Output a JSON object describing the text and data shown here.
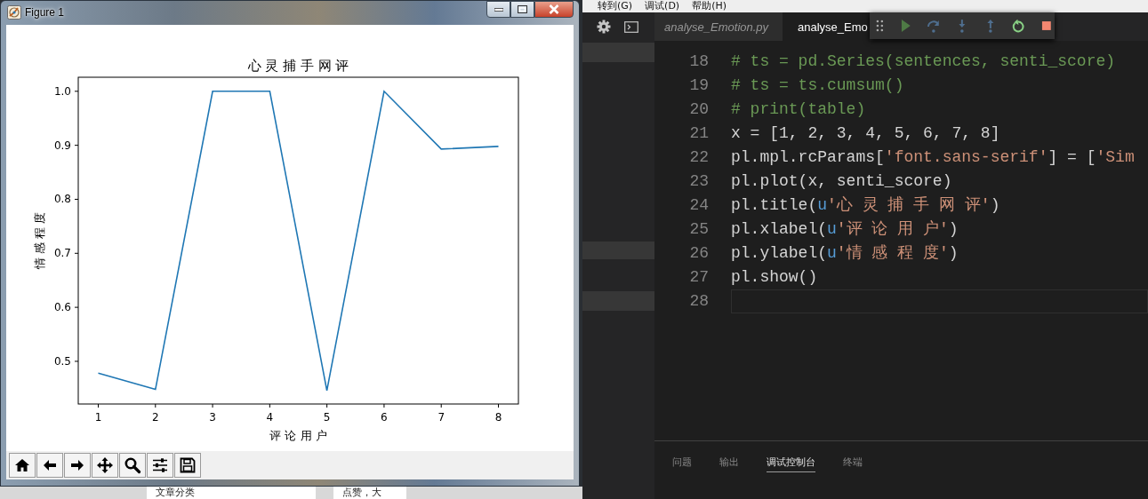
{
  "desktop": {
    "panels": [
      "文章分类",
      "点赞，大"
    ]
  },
  "figure_window": {
    "title": "Figure 1",
    "chart_data": {
      "type": "line",
      "title": "心 灵 捕 手 网 评",
      "xlabel": "评 论 用 户",
      "ylabel": "情 感 程 度",
      "x": [
        1,
        2,
        3,
        4,
        5,
        6,
        7,
        8
      ],
      "series": [
        {
          "color": "#1f77b4",
          "values": [
            0.478,
            0.448,
            1.0,
            1.0,
            0.446,
            1.0,
            0.893,
            0.898
          ]
        }
      ],
      "xlim": [
        0.65,
        8.35
      ],
      "ylim": [
        0.421,
        1.026
      ],
      "xticks": [
        1,
        2,
        3,
        4,
        5,
        6,
        7,
        8
      ],
      "yticks": [
        0.5,
        0.6,
        0.7,
        0.8,
        0.9,
        {
          "value": 1.0,
          "label": "1.0"
        }
      ]
    }
  },
  "editor": {
    "menu": [
      "转到(G)",
      "调试(D)",
      "帮助(H)"
    ],
    "tabs": [
      {
        "label": "analyse_Emotion.py",
        "selected": false,
        "preview": true
      },
      {
        "label": "analyse_Emo",
        "selected": true,
        "preview": false
      }
    ],
    "code_lines": [
      {
        "number": "18",
        "current": false,
        "tokens": [
          {
            "kind": "comment",
            "text": "# ts = pd.Series(sentences, senti_score)"
          }
        ]
      },
      {
        "number": "19",
        "current": false,
        "tokens": [
          {
            "kind": "comment",
            "text": "# ts = ts.cumsum()"
          }
        ]
      },
      {
        "number": "20",
        "current": false,
        "tokens": [
          {
            "kind": "comment",
            "text": "# print(table)"
          }
        ]
      },
      {
        "number": "21",
        "current": false,
        "tokens": [
          {
            "kind": "plain",
            "text": "x = [1, 2, 3, 4, 5, 6, 7, 8]"
          }
        ]
      },
      {
        "number": "22",
        "current": false,
        "tokens": [
          {
            "kind": "plain",
            "text": "pl.mpl.rcParams["
          },
          {
            "kind": "string",
            "text": "'font.sans-serif'"
          },
          {
            "kind": "plain",
            "text": "] = ["
          },
          {
            "kind": "string",
            "text": "'Sim"
          }
        ]
      },
      {
        "number": "23",
        "current": false,
        "tokens": [
          {
            "kind": "plain",
            "text": "pl.plot(x, senti_score)"
          }
        ]
      },
      {
        "number": "24",
        "current": false,
        "tokens": [
          {
            "kind": "plain",
            "text": "pl.title("
          },
          {
            "kind": "prefix",
            "text": "u"
          },
          {
            "kind": "string",
            "text": "'心 灵 捕 手 网 评'"
          },
          {
            "kind": "plain",
            "text": ")"
          }
        ]
      },
      {
        "number": "25",
        "current": false,
        "tokens": [
          {
            "kind": "plain",
            "text": "pl.xlabel("
          },
          {
            "kind": "prefix",
            "text": "u"
          },
          {
            "kind": "string",
            "text": "'评 论 用 户'"
          },
          {
            "kind": "plain",
            "text": ")"
          }
        ]
      },
      {
        "number": "26",
        "current": false,
        "tokens": [
          {
            "kind": "plain",
            "text": "pl.ylabel("
          },
          {
            "kind": "prefix",
            "text": "u"
          },
          {
            "kind": "string",
            "text": "'情 感 程 度'"
          },
          {
            "kind": "plain",
            "text": ")"
          }
        ]
      },
      {
        "number": "27",
        "current": false,
        "tokens": [
          {
            "kind": "plain",
            "text": "pl.show()"
          }
        ]
      },
      {
        "number": "28",
        "current": true
      }
    ],
    "panel_tabs": [
      {
        "label": "问题",
        "selected": false
      },
      {
        "label": "输出",
        "selected": false
      },
      {
        "label": "调试控制台",
        "selected": true
      },
      {
        "label": "终端",
        "selected": false
      }
    ]
  }
}
